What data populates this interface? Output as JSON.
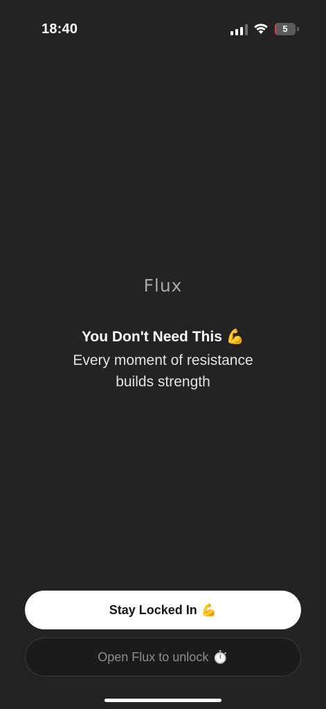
{
  "status_bar": {
    "time": "18:40",
    "battery_level": "5",
    "battery_fraction": 0.05,
    "icons": [
      "signal-icon",
      "wifi-icon",
      "battery-icon"
    ]
  },
  "app": {
    "logo_text": "Flux"
  },
  "message": {
    "title": "You Don't Need This",
    "title_emoji": "💪",
    "subtitle": "Every moment of resistance builds strength"
  },
  "buttons": {
    "primary_label": "Stay Locked In",
    "primary_emoji": "💪",
    "secondary_label": "Open Flux to unlock",
    "secondary_emoji": "⏱️"
  },
  "colors": {
    "background": "#232323",
    "primary_button_bg": "#ffffff",
    "secondary_button_bg": "#1b1b1b",
    "battery_low": "#d9413b"
  }
}
